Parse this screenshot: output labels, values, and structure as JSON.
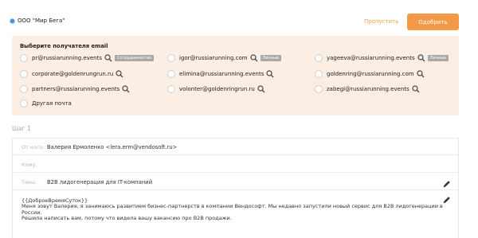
{
  "header": {
    "company": "ООО \"Мир Бега\"",
    "skip_label": "Пропустить",
    "approve_label": "Одобрить"
  },
  "recipients": {
    "title": "Выберите получателя email",
    "options": [
      {
        "label": "pr@russiarunning.events",
        "tag": "Сотрудничество"
      },
      {
        "label": "igor@russiarunning.com",
        "tag": "Личные"
      },
      {
        "label": "yageeva@russiarunning.events",
        "tag": "Личные"
      },
      {
        "label": "corporate@goldenrungrun.ru"
      },
      {
        "label": "elimina@russiarunning.events"
      },
      {
        "label": "goldenring@russiarunning.com"
      },
      {
        "label": "partners@russiarunning.events"
      },
      {
        "label": "volonter@goldenringrun.ru"
      },
      {
        "label": "zabegi@russiarunning.events"
      },
      {
        "label": "Другая почта"
      }
    ]
  },
  "step_label": "Шаг 1",
  "email": {
    "from_label": "От кого:",
    "from_value": "Валерия Ермоленко <lera.erm@vendosoft.ru>",
    "to_label": "Кому:",
    "subject_label": "Тема:",
    "subject_value": "B2B лидогенерация для IT-компаний",
    "body_lines": [
      "{{ДоброеВремяСуток}}",
      "Меня зовут Валерия, я занимаюсь развитием бизнес-партнерств в компании Вендософт. Мы недавно запустили новый сервис для B2B лидогенерации в",
      "России.",
      "Решила написать вам, потому что видела вашу вакансию про B2B продажи."
    ]
  },
  "colors": {
    "accent": "#f39a48",
    "recipients_bg": "#fbeee4",
    "company_dot": "#4a8fd6"
  }
}
